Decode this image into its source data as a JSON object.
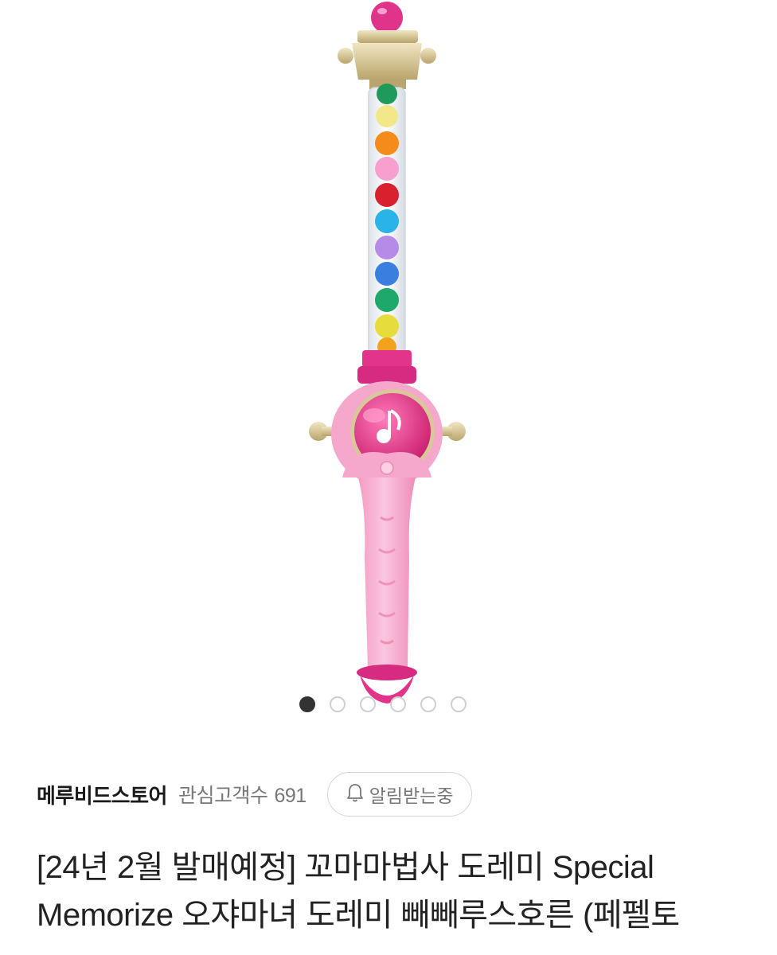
{
  "product_image": {
    "alt": "wand toy",
    "carousel": {
      "total": 6,
      "active_index": 0
    }
  },
  "store": {
    "name": "메루비드스토어",
    "followers_label": "관심고객수",
    "followers_count": "691",
    "alert_button_label": "알림받는중"
  },
  "product": {
    "title_line1": "[24년 2월 발매예정] 꼬마마법사 도레미 Special",
    "title_line2": "Memorize 오쟈마녀 도레미 빼빼루스호른 (페펠토"
  },
  "colors": {
    "accent_pink": "#e8418f",
    "handle_pink": "#f7a8cc",
    "gold": "#d9c79a"
  },
  "icons": {
    "bell": "bell-icon",
    "music_note": "music-note-icon"
  }
}
